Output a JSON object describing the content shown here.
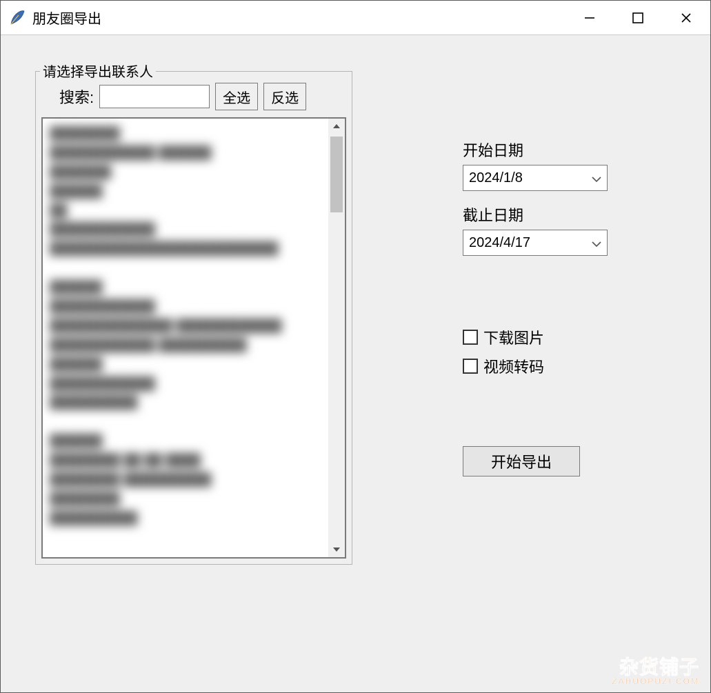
{
  "window": {
    "title": "朋友圈导出"
  },
  "contacts": {
    "legend": "请选择导出联系人",
    "search_label": "搜索:",
    "search_value": "",
    "select_all_label": "全选",
    "invert_label": "反选"
  },
  "dates": {
    "start_label": "开始日期",
    "start_value": "2024/1/8",
    "end_label": "截止日期",
    "end_value": "2024/4/17"
  },
  "options": {
    "download_images_label": "下载图片",
    "download_images_checked": false,
    "video_transcode_label": "视频转码",
    "video_transcode_checked": false
  },
  "actions": {
    "export_label": "开始导出"
  },
  "watermark": {
    "line1": "杂货铺子",
    "line2": "ZAHUOPUZI.COM"
  }
}
